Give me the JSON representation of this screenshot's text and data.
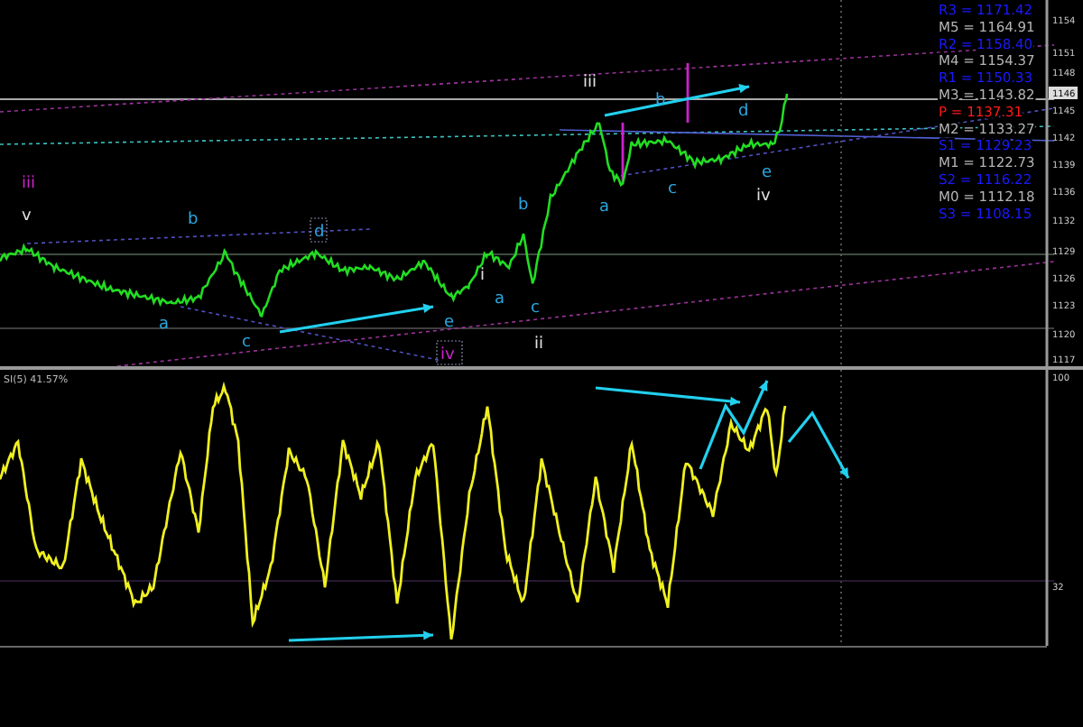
{
  "chart": {
    "pivot_levels": [
      {
        "label": "R3 = 1171.42",
        "color": "#1a1aff"
      },
      {
        "label": "M5 = 1164.91",
        "color": "#b4b4b4"
      },
      {
        "label": "R2 = 1158.40",
        "color": "#1a1aff"
      },
      {
        "label": "M4 = 1154.37",
        "color": "#b4b4b4"
      },
      {
        "label": "R1 = 1150.33",
        "color": "#1a1aff"
      },
      {
        "label": "M3 = 1143.82",
        "color": "#b4b4b4"
      },
      {
        "label": "P  = 1137.31",
        "color": "#ff1a1a"
      },
      {
        "label": "M2 = 1133.27",
        "color": "#b4b4b4"
      },
      {
        "label": "S1 = 1129.23",
        "color": "#1a1aff"
      },
      {
        "label": "M1 = 1122.73",
        "color": "#b4b4b4"
      },
      {
        "label": "S2 = 1116.22",
        "color": "#1a1aff"
      },
      {
        "label": "M0 = 1112.18",
        "color": "#b4b4b4"
      },
      {
        "label": "S3 = 1108.15",
        "color": "#1a1aff"
      }
    ],
    "wave_labels": [
      {
        "text": "iii",
        "color": "#cc22cc"
      },
      {
        "text": "v",
        "color": "#e0e0e0"
      },
      {
        "text": "b",
        "color": "#2aa8e0"
      },
      {
        "text": "d",
        "color": "#2aa8e0"
      },
      {
        "text": "a",
        "color": "#2aa8e0"
      },
      {
        "text": "c",
        "color": "#2aa8e0"
      },
      {
        "text": "e",
        "color": "#2aa8e0"
      },
      {
        "text": "iv",
        "color": "#cc22cc"
      },
      {
        "text": "i",
        "color": "#e0e0e0"
      },
      {
        "text": "b",
        "color": "#2aa8e0"
      },
      {
        "text": "a",
        "color": "#2aa8e0"
      },
      {
        "text": "c",
        "color": "#2aa8e0"
      },
      {
        "text": "ii",
        "color": "#e0e0e0"
      },
      {
        "text": "iii",
        "color": "#e0e0e0"
      },
      {
        "text": "b",
        "color": "#2aa8e0"
      },
      {
        "text": "d",
        "color": "#2aa8e0"
      },
      {
        "text": "a",
        "color": "#2aa8e0"
      },
      {
        "text": "c",
        "color": "#2aa8e0"
      },
      {
        "text": "e",
        "color": "#2aa8e0"
      },
      {
        "text": "iv",
        "color": "#e0e0e0"
      }
    ],
    "price_axis": [
      "1154",
      "1151",
      "1148",
      "1146",
      "1145",
      "1142",
      "1139",
      "1136",
      "1132",
      "1129",
      "1126",
      "1123",
      "1120",
      "1117"
    ],
    "oscillator": {
      "title": "SI(5) 41.57%",
      "axis": [
        "100",
        "32"
      ]
    }
  }
}
